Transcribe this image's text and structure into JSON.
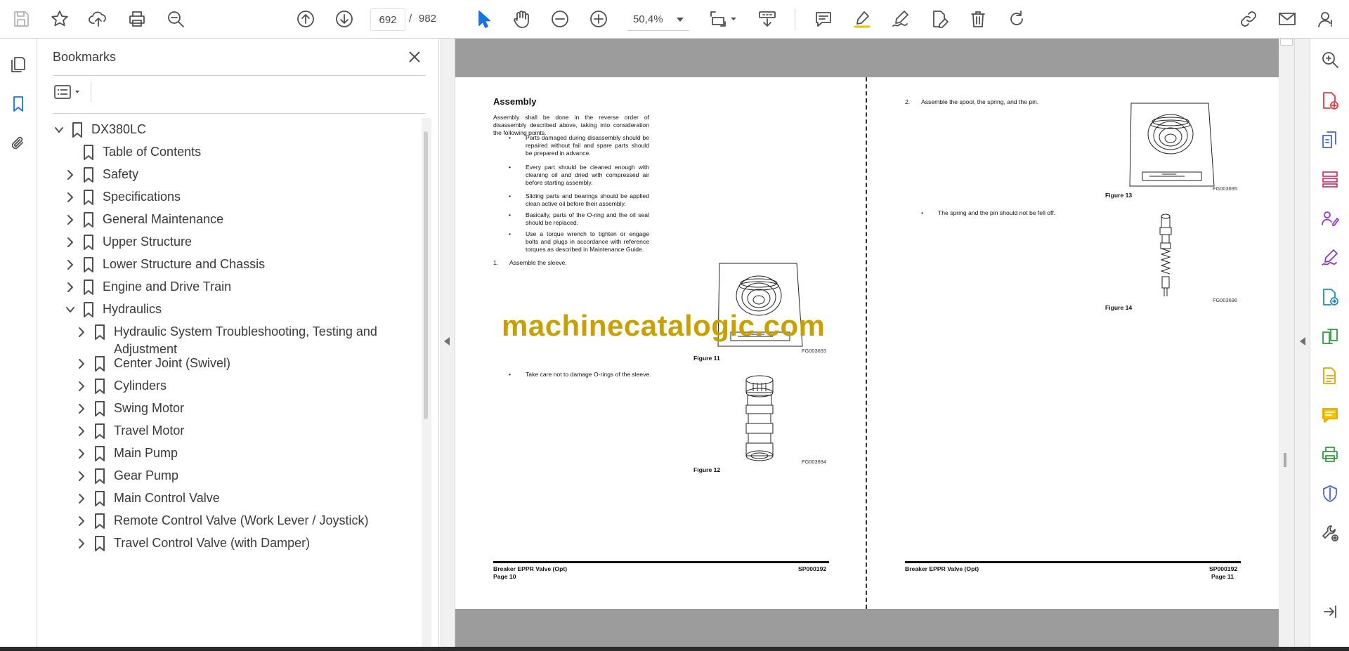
{
  "toolbar": {
    "current_page": "692",
    "page_separator": "/",
    "total_pages": "982",
    "zoom": "50,4%"
  },
  "bookmarks": {
    "title": "Bookmarks",
    "items": [
      {
        "label": "DX380LC",
        "expand": "expanded"
      },
      {
        "label": "Table of Contents",
        "expand": "none"
      },
      {
        "label": "Safety",
        "expand": "collapsed"
      },
      {
        "label": "Specifications",
        "expand": "collapsed"
      },
      {
        "label": "General Maintenance",
        "expand": "collapsed"
      },
      {
        "label": "Upper Structure",
        "expand": "collapsed"
      },
      {
        "label": "Lower Structure and Chassis",
        "expand": "collapsed"
      },
      {
        "label": "Engine and Drive Train",
        "expand": "collapsed"
      },
      {
        "label": "Hydraulics",
        "expand": "expanded"
      },
      {
        "label": "Hydraulic System Troubleshooting, Testing and Adjustment",
        "expand": "collapsed"
      },
      {
        "label": "Center Joint (Swivel)",
        "expand": "collapsed"
      },
      {
        "label": "Cylinders",
        "expand": "collapsed"
      },
      {
        "label": "Swing Motor",
        "expand": "collapsed"
      },
      {
        "label": "Travel Motor",
        "expand": "collapsed"
      },
      {
        "label": "Main Pump",
        "expand": "collapsed"
      },
      {
        "label": "Gear Pump",
        "expand": "collapsed"
      },
      {
        "label": "Main Control Valve",
        "expand": "collapsed"
      },
      {
        "label": "Remote Control Valve (Work Lever / Joystick)",
        "expand": "collapsed"
      },
      {
        "label": "Travel Control Valve (with Damper)",
        "expand": "collapsed"
      }
    ]
  },
  "document": {
    "left_page": {
      "heading": "Assembly",
      "intro": "Assembly shall be done in the reverse order of disassembly described above, taking into consideration the following points.",
      "bullets": [
        "Parts damaged during disassembly should be repaired without fail and spare parts should be prepared in advance.",
        "Every part should be cleaned enough with cleaning oil and dried with compressed air before starting assembly.",
        "Sliding parts and bearings should be applied clean active oil before their assembly.",
        "Basically, parts of the O-ring and the oil seal should be replaced.",
        "Use a torque wrench to tighten or engage bolts and plugs in accordance with reference torques as described in Maintenance Guide."
      ],
      "step1_num": "1.",
      "step1_text": "Assemble the sleeve.",
      "fig11_code": "FG003693",
      "fig11_caption": "Figure 11",
      "note": "Take care not to damage O-rings of the sleeve.",
      "fig12_code": "FG003694",
      "fig12_caption": "Figure 12",
      "footer_title": "Breaker EPPR Valve (Opt)",
      "footer_page": "Page 10",
      "footer_code": "SP000192"
    },
    "right_page": {
      "step2_num": "2.",
      "step2_text": "Assemble the spool, the spring, and the pin.",
      "fig13_code": "FG003695",
      "fig13_caption": "Figure 13",
      "note": "The spring and the pin should not be fell off.",
      "fig14_code": "FG003696",
      "fig14_caption": "Figure 14",
      "footer_title": "Breaker EPPR Valve (Opt)",
      "footer_page": "Page 11",
      "footer_code": "SP000192"
    },
    "watermark": "machinecatalogic.com"
  },
  "colors": {
    "accent": "#1473e6",
    "watermark": "#c9a000",
    "viewport_bg": "#9c9c9c"
  },
  "icons": {
    "toolbar": [
      "save-icon",
      "star-icon",
      "upload-icon",
      "print-icon",
      "find-icon",
      "page-up-icon",
      "page-down-icon",
      "select-pointer-icon",
      "hand-icon",
      "zoom-out-icon",
      "zoom-in-icon",
      "fit-page-icon",
      "scroll-mode-icon",
      "comment-icon",
      "highlight-icon",
      "sign-icon",
      "edit-pdf-icon",
      "delete-icon",
      "rotate-icon",
      "share-link-icon",
      "email-icon",
      "account-icon"
    ],
    "right_rail": [
      "search-icon",
      "create-pdf-icon",
      "export-pdf-icon",
      "organize-pages-icon",
      "request-signatures-icon",
      "fill-sign-icon",
      "send-review-icon",
      "compare-files-icon",
      "scan-ocr-icon",
      "comment-tool-icon",
      "print-production-icon",
      "protect-icon",
      "more-tools-icon",
      "collapse-rail-icon"
    ]
  }
}
